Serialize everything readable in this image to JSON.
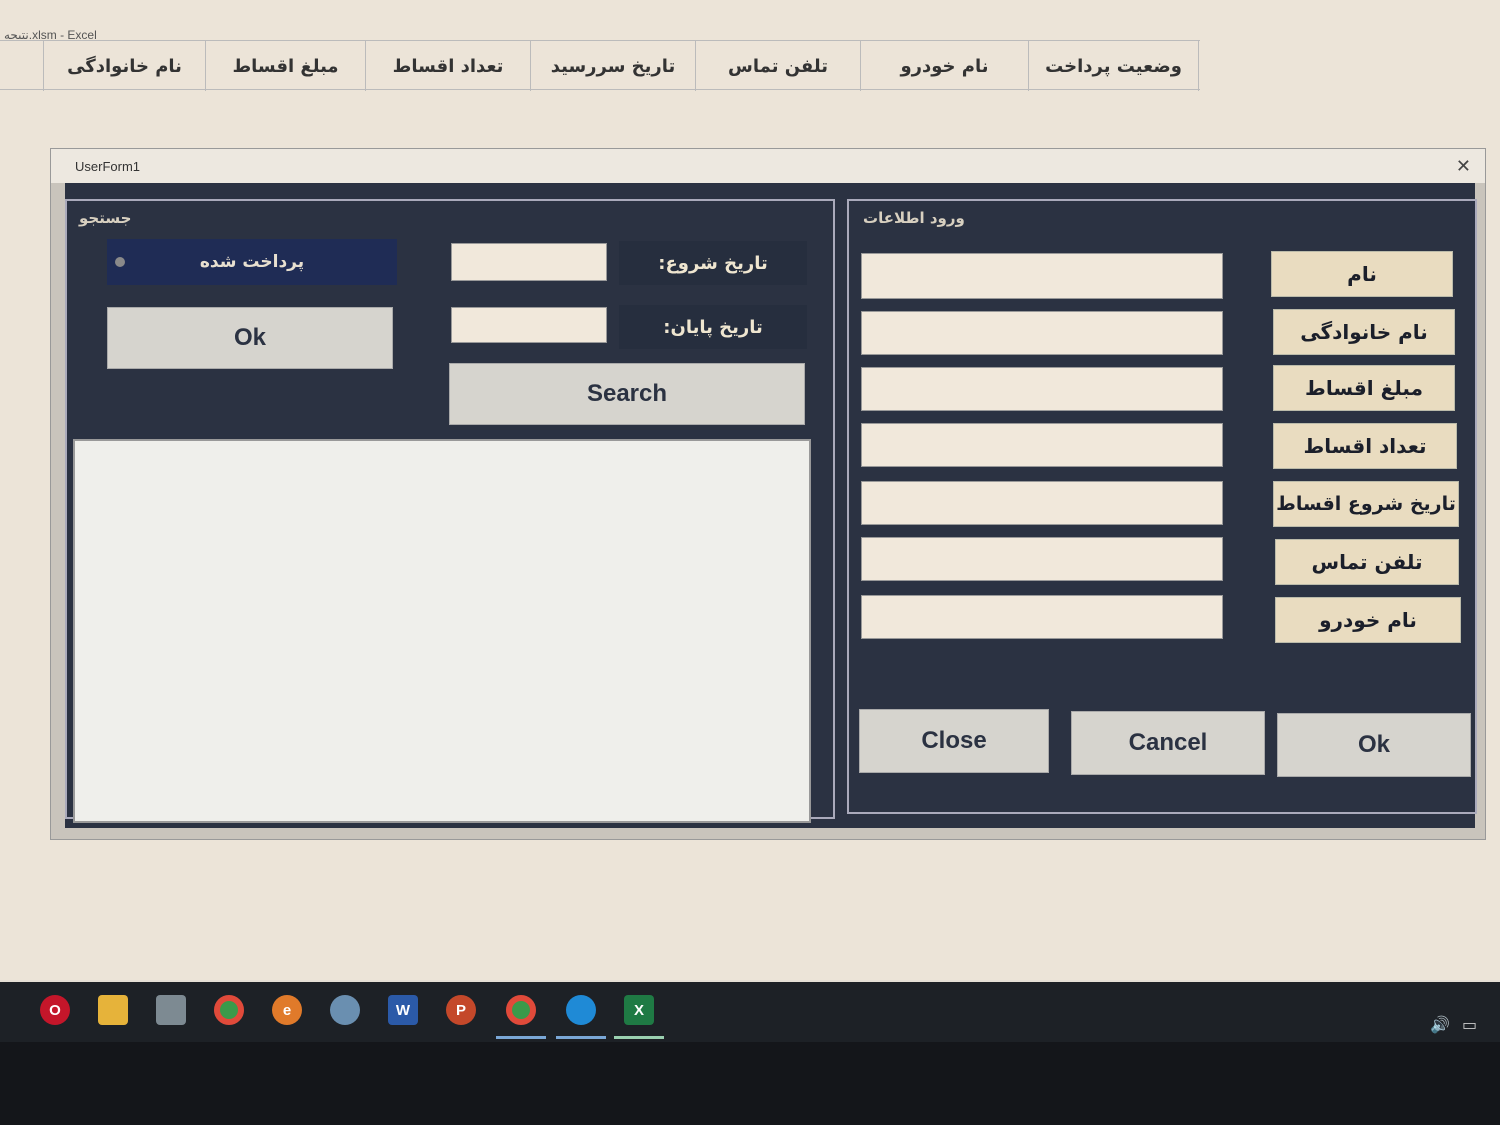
{
  "excel": {
    "window_title": "نتیجه.xlsm - Excel",
    "headers": [
      "وضعیت پرداخت",
      "نام خودرو",
      "تلفن تماس",
      "تاریخ سررسید",
      "تعداد اقساط",
      "مبلغ اقساط",
      "نام خانوادگی"
    ]
  },
  "userform": {
    "title": "UserForm1",
    "close_glyph": "✕"
  },
  "search_panel": {
    "label": "جستجو",
    "paid_checkbox_label": "پرداخت شده",
    "ok_button": "Ok",
    "start_date_label": "تاریخ شروع:",
    "end_date_label": "تاریخ پایان:",
    "start_date_value": "",
    "end_date_value": "",
    "search_button": "Search"
  },
  "input_panel": {
    "label": "ورود اطلاعات",
    "fields": [
      "نام",
      "نام خانوادگی",
      "مبلغ اقساط",
      "تعداد اقساط",
      "تاریخ شروع اقساط",
      "تلفن تماس",
      "نام خودرو"
    ],
    "values": [
      "",
      "",
      "",
      "",
      "",
      "",
      ""
    ],
    "buttons": {
      "close": "Close",
      "cancel": "Cancel",
      "ok": "Ok"
    }
  },
  "taskbar": {
    "icons": [
      "opera-icon",
      "file-explorer-icon",
      "app-icon",
      "chrome-icon",
      "browser-icon",
      "paint-icon",
      "word-icon",
      "powerpoint-icon",
      "chrome-icon",
      "edge-icon",
      "excel-icon"
    ],
    "icon_glyphs": {
      "word": "W",
      "powerpoint": "P",
      "excel": "X",
      "opera": "O",
      "browser": "e"
    },
    "tray": {
      "volume": "🔊",
      "battery": "▭"
    }
  },
  "colors": {
    "form_bg": "#2b3242",
    "gold_button": "#e9dcc0",
    "input_bg": "#f1e8db",
    "checkbox_bg": "#1f2c55"
  }
}
